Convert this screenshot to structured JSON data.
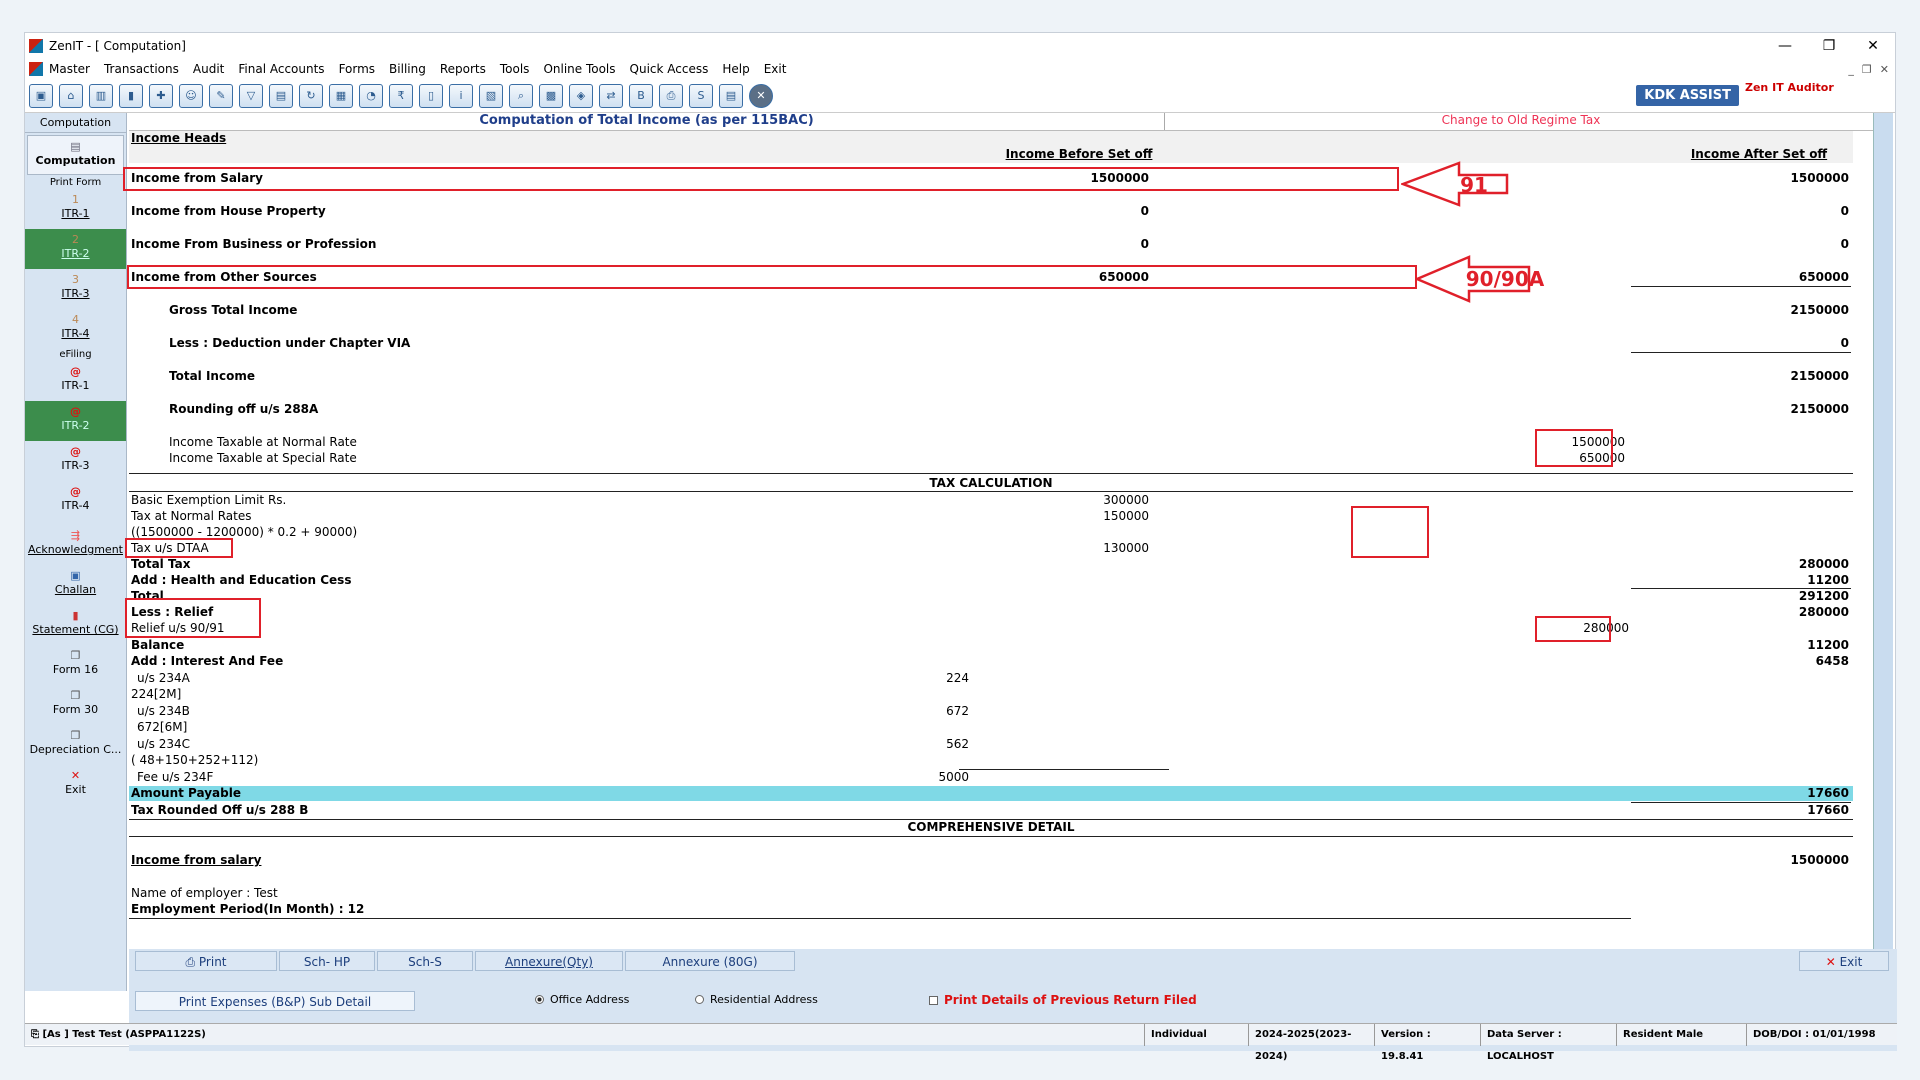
{
  "window": {
    "title": "ZenIT - [ Computation]",
    "controls": [
      "—",
      "❐",
      "✕"
    ]
  },
  "menu": [
    "Master",
    "Transactions",
    "Audit",
    "Final Accounts",
    "Forms",
    "Billing",
    "Reports",
    "Tools",
    "Online Tools",
    "Quick Access",
    "Help",
    "Exit"
  ],
  "toolbar": {
    "kdk_label": "KDK ASSIST",
    "zen_label": "Zen IT Auditor"
  },
  "sidebar": {
    "header": "Computation",
    "computation": "Computation",
    "print_form": "Print Form",
    "print_items": [
      {
        "num": "1",
        "label": "ITR-1"
      },
      {
        "num": "2",
        "label": "ITR-2"
      },
      {
        "num": "3",
        "label": "ITR-3"
      },
      {
        "num": "4",
        "label": "ITR-4"
      }
    ],
    "efiling": "eFiling",
    "efile_items": [
      "ITR-1",
      "ITR-2",
      "ITR-3",
      "ITR-4"
    ],
    "tools": [
      "Acknowledgment",
      "Challan",
      "Statement (CG)",
      "Form 16",
      "Form 30",
      "Depreciation C...",
      "Exit"
    ]
  },
  "header": {
    "title": "Computation of Total Income (as per 115BAC)",
    "regime_link": "Change to Old Regime Tax"
  },
  "sheet": {
    "income_heads": "Income Heads",
    "col_before": "Income Before Set off",
    "col_after": "Income After Set off",
    "salary": {
      "label": "Income from Salary",
      "before": "1500000",
      "after": "1500000"
    },
    "house": {
      "label": "Income from House Property",
      "before": "0",
      "after": "0"
    },
    "business": {
      "label": "Income From Business or Profession",
      "before": "0",
      "after": "0"
    },
    "other": {
      "label": "Income from Other Sources",
      "before": "650000",
      "after": "650000"
    },
    "gross": {
      "label": "Gross Total Income",
      "after": "2150000"
    },
    "deduction": {
      "label": "Less : Deduction under Chapter VIA",
      "after": "0"
    },
    "total_income": {
      "label": "Total Income",
      "after": "2150000"
    },
    "rounding": {
      "label": "Rounding off u/s 288A",
      "after": "2150000"
    },
    "normal_rate": {
      "label": "Income Taxable at Normal Rate",
      "value": "1500000"
    },
    "special_rate": {
      "label": "Income Taxable at Special Rate",
      "value": "650000"
    },
    "tax_calc_title": "TAX CALCULATION",
    "exemption": {
      "label": "Basic Exemption Limit Rs.",
      "value": "300000"
    },
    "tax_normal": {
      "label": "Tax at Normal Rates",
      "value": "150000"
    },
    "tax_formula": "((1500000 - 1200000) * 0.2 + 90000)",
    "dtaa": {
      "label": "Tax u/s DTAA",
      "value": "130000"
    },
    "total_tax": {
      "label": "Total Tax",
      "value": "280000"
    },
    "cess": {
      "label": "Add : Health and Education Cess",
      "value": "11200"
    },
    "total": {
      "label": "Total",
      "value": "291200"
    },
    "relief": {
      "label": "Less : Relief",
      "value": "280000"
    },
    "relief_9091": {
      "label": "Relief u/s 90/91",
      "value": "280000"
    },
    "balance": {
      "label": "Balance",
      "value": "11200"
    },
    "interest": {
      "label": "Add : Interest And Fee",
      "value": "6458"
    },
    "s234a": {
      "label": "u/s 234A",
      "value": "224"
    },
    "s234a_detail": "224[2M]",
    "s234b": {
      "label": "u/s 234B",
      "value": "672"
    },
    "s234b_detail": "672[6M]",
    "s234c": {
      "label": "u/s 234C",
      "value": "562"
    },
    "s234c_detail": "( 48+150+252+112)",
    "fee234f": {
      "label": "Fee u/s 234F",
      "value": "5000"
    },
    "payable": {
      "label": "Amount Payable",
      "value": "17660"
    },
    "rounded": {
      "label": "Tax Rounded Off u/s 288 B",
      "value": "17660"
    },
    "comp_title": "COMPREHENSIVE DETAIL",
    "salary_head": {
      "label": "Income from salary",
      "value": "1500000"
    },
    "employer": "Name of employer : Test",
    "employment": "Employment Period(In Month) : 12",
    "annot_91": "91",
    "annot_90": "90/90A"
  },
  "bottom": {
    "print": "Print",
    "sch_hp": "Sch- HP",
    "sch_s": "Sch-S",
    "annex_qty": "Annexure(Qty)",
    "annex_80g": "Annexure (80G)",
    "exit": "Exit",
    "print_expenses": "Print Expenses (B&P) Sub Detail",
    "office": "Office Address",
    "residential": "Residential Address",
    "prev_return": "Print Details of Previous Return Filed"
  },
  "status": {
    "user": "[As ] Test Test (ASPPA1122S)",
    "type": "Individual",
    "year": "2024-2025(2023-2024)",
    "version": "Version : 19.8.41",
    "server": "Data Server : LOCALHOST",
    "resident": "Resident Male",
    "dob": "DOB/DOI : 01/01/1998"
  }
}
